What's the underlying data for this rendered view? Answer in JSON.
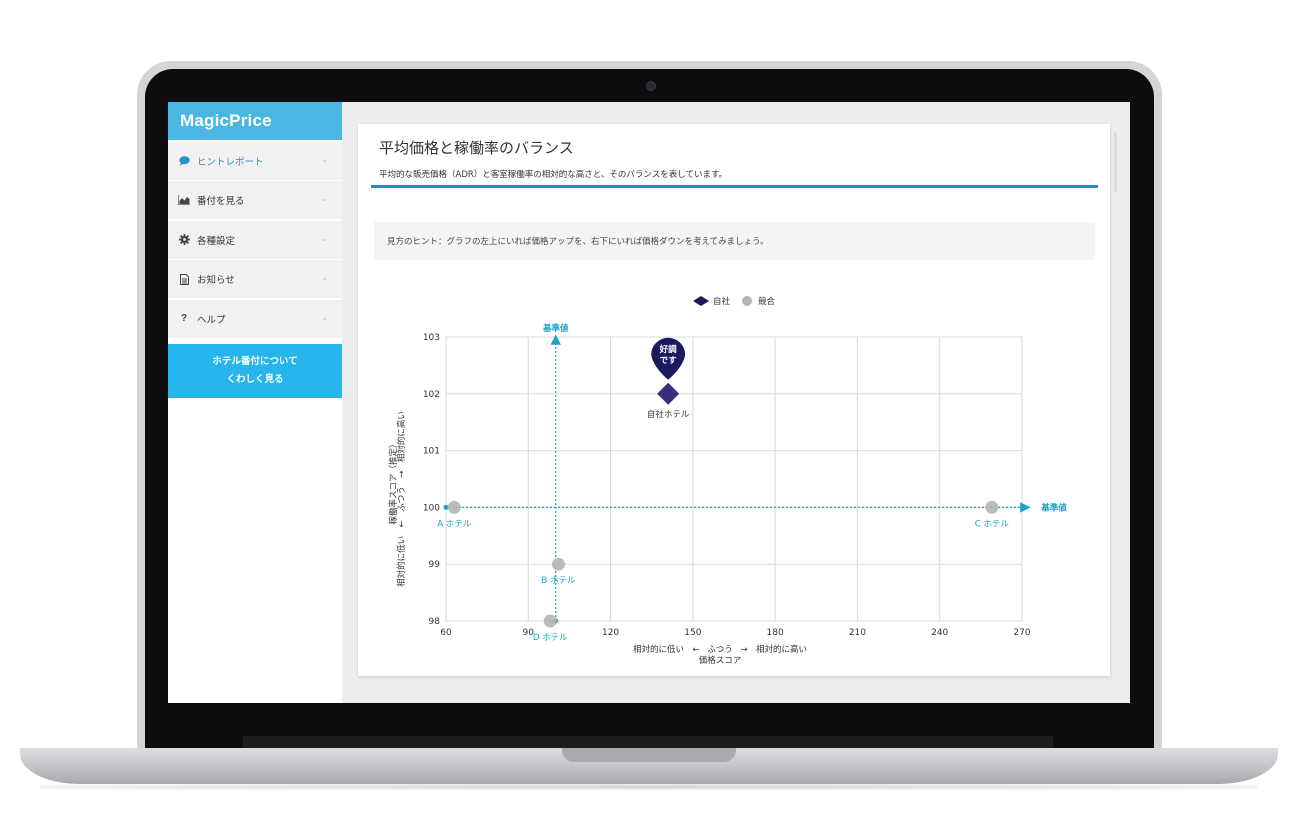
{
  "app": {
    "logo": "MagicPrice"
  },
  "sidebar": {
    "items": [
      {
        "label": "ヒントレポート",
        "icon": "speech-bubble-icon",
        "active": true
      },
      {
        "label": "番付を見る",
        "icon": "area-chart-icon",
        "active": false
      },
      {
        "label": "各種設定",
        "icon": "gear-icon",
        "active": false
      },
      {
        "label": "お知らせ",
        "icon": "document-icon",
        "active": false
      },
      {
        "label": "ヘルプ",
        "icon": "question-icon",
        "active": false
      }
    ],
    "cta_line1": "ホテル番付について",
    "cta_line2": "くわしく見る"
  },
  "page": {
    "title": "平均価格と稼働率のバランス",
    "subtitle": "平均的な販売価格（ADR）と客室稼働率の相対的な高さと、そのバランスを表しています。",
    "hint": "見方のヒント：グラフの左上にいれば価格アップを、右下にいれば価格ダウンを考えてみましょう。"
  },
  "colors": {
    "accent": "#1f8ec6",
    "own": "#3a2d7d",
    "competitor": "#b5b5b5",
    "reference": "#1aa3c8"
  },
  "chart_data": {
    "type": "scatter",
    "legend": {
      "placement": "top-center",
      "own_label": "自社",
      "competitor_label": "競合"
    },
    "xlabel_left": "相対的に低い",
    "xlabel_arrow_left": "←",
    "xlabel_mid": "ふつう",
    "xlabel_arrow_right": "→",
    "xlabel_right": "相対的に高い",
    "xlabel_name": "価格スコア",
    "ylabel_line1": "相対的に低い　←　ふつう　→　相対的に高い",
    "ylabel_line2": "稼働率スコア（推定）",
    "xlim": [
      60,
      270
    ],
    "ylim": [
      98,
      103
    ],
    "xticks": [
      60,
      90,
      120,
      150,
      180,
      210,
      240,
      270
    ],
    "yticks": [
      98,
      99,
      100,
      101,
      102,
      103
    ],
    "reference": {
      "x": 100,
      "y": 100,
      "label": "基準値"
    },
    "series": [
      {
        "name": "自社",
        "points": [
          {
            "x": 141,
            "y": 102,
            "label": "自社ホテル"
          }
        ]
      },
      {
        "name": "競合",
        "points": [
          {
            "x": 63,
            "y": 100,
            "label": "A ホテル"
          },
          {
            "x": 101,
            "y": 99,
            "label": "B ホテル"
          },
          {
            "x": 259,
            "y": 100,
            "label": "C ホテル"
          },
          {
            "x": 98,
            "y": 98,
            "label": "D ホテル"
          }
        ]
      }
    ],
    "badge_line1": "好調",
    "badge_line2": "です",
    "grid": true
  }
}
